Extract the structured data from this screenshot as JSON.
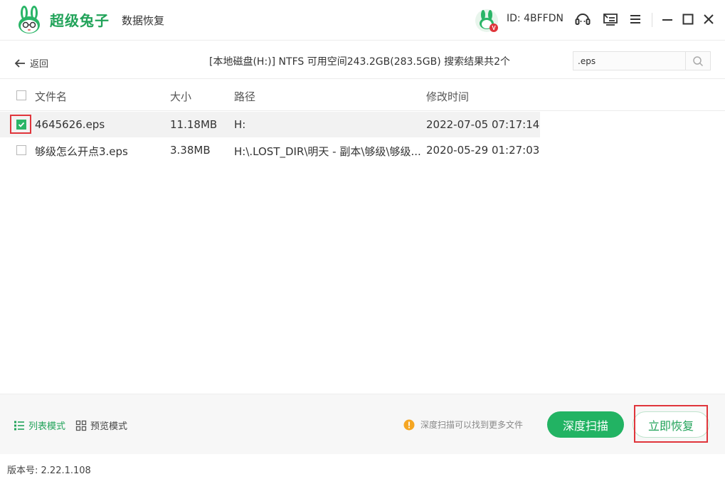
{
  "app": {
    "brand_name": "超级兔子",
    "product_name": "数据恢复",
    "user_id": "ID: 4BFFDN",
    "avatar_badge": "V",
    "accent_color": "#22b363"
  },
  "nav": {
    "back_label": "返回",
    "disk_info": "[本地磁盘(H:)] NTFS 可用空间243.2GB(283.5GB) 搜索结果共2个",
    "search_value": ".eps"
  },
  "table": {
    "headers": {
      "name": "文件名",
      "size": "大小",
      "path": "路径",
      "mtime": "修改时间"
    },
    "rows": [
      {
        "name": "4645626.eps",
        "size": "11.18MB",
        "path": "H:",
        "mtime": "2022-07-05 07:17:14",
        "checked": true
      },
      {
        "name": "够级怎么开点3.eps",
        "size": "3.38MB",
        "path": "H:\\.LOST_DIR\\明天 - 副本\\够级\\够级...",
        "mtime": "2020-05-29 01:27:03",
        "checked": false
      }
    ]
  },
  "footer": {
    "list_mode_label": "列表模式",
    "preview_mode_label": "预览模式",
    "hint_text": "深度扫描可以找到更多文件",
    "deep_scan_label": "深度扫描",
    "recover_label": "立即恢复",
    "version_label": "版本号:",
    "version": "2.22.1.108"
  },
  "icons": {
    "back": "arrow-left-icon",
    "support": "headset-icon",
    "feedback": "feedback-icon",
    "menu": "menu-icon",
    "minimize": "minimize-icon",
    "maximize": "maximize-icon",
    "close": "close-icon",
    "search": "search-icon",
    "list_mode": "list-icon",
    "preview_mode": "grid-icon",
    "hint": "warning-icon"
  }
}
